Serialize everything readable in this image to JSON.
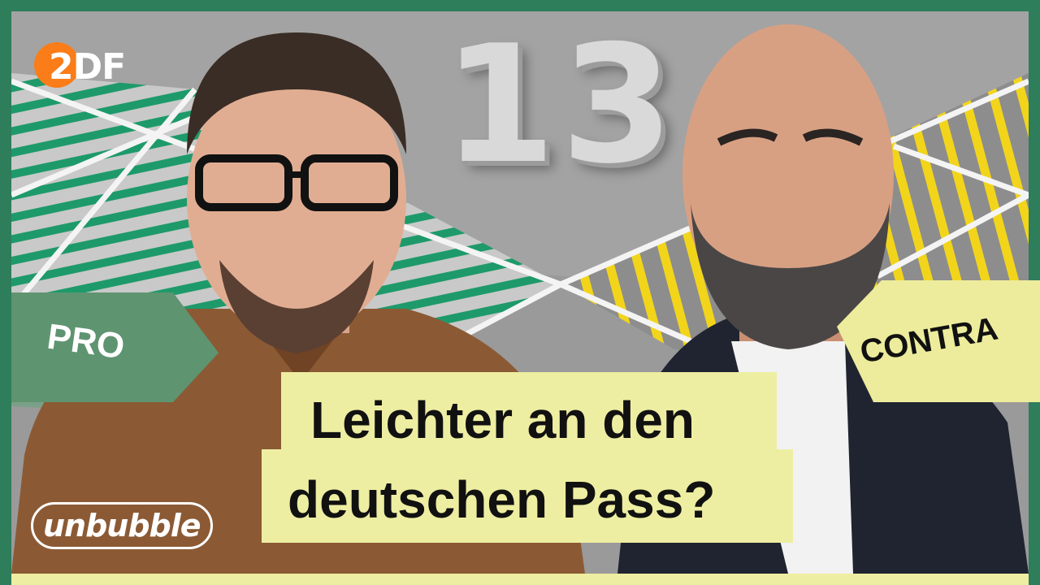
{
  "logo": {
    "broadcaster": "2DF",
    "brand": "unbubble"
  },
  "background": {
    "number": "13"
  },
  "tags": {
    "pro": "PRO",
    "contra": "CONTRA"
  },
  "headline": {
    "line1": "Leichter an den",
    "line2": "deutschen Pass?"
  },
  "colors": {
    "frame_green": "#2e7d5b",
    "green_stripes": "#1e9a6a",
    "yellow_stripes": "#f2d51b",
    "title_bg": "#eeeea2",
    "pro_tag": "#5f9470",
    "contra_tag": "#ecec9c",
    "zdf_orange": "#fa7d19"
  }
}
